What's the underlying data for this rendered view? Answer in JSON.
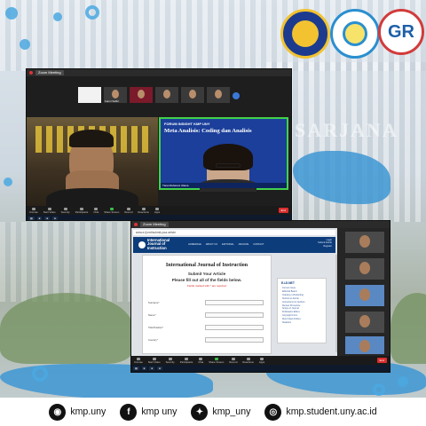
{
  "watermark": "SARJANA",
  "zoom_top": {
    "tabs": [
      "Zoom Meeting"
    ],
    "thumbnails": [
      {
        "name": ""
      },
      {
        "name": "Fanni Safitri"
      },
      {
        "name": ""
      },
      {
        "name": ""
      },
      {
        "name": ""
      },
      {
        "name": ""
      }
    ],
    "slide": {
      "header": "FORUM INSIGHT KMP UNY",
      "title": "Meta Analisis: Coding dan Analisis",
      "speaker_label": "Tiara Maharani Jiliana"
    },
    "toolbar": [
      "Unmute",
      "Start Video",
      "Security",
      "Participants",
      "Chat",
      "Share Screen",
      "Record",
      "Reactions",
      "Apps"
    ],
    "end_label": "End"
  },
  "zoom_bottom": {
    "address": "www.e-iji.net/submit-your-article",
    "journal_logo": "International Journal of Instruction",
    "nav": [
      "HOMEPAGE",
      "ABOUT US",
      "EDITORIAL",
      "ARCHIVE",
      "CONTACT"
    ],
    "login_links": [
      "Login",
      "Submit Article",
      "Register"
    ],
    "page_title": "International Journal of Instruction",
    "submit_heading": "Submit Your Article",
    "instruction": "Please fill out all of the fields below.",
    "required_note": "Fields marked with * are required",
    "fields": [
      "Surname*",
      "Name*",
      "Title/Position*",
      "Country*"
    ],
    "sidebar_title": "E-IJI.NET",
    "sidebar_links": [
      "Current Issue",
      "Editorial Board",
      "Indexing / Abstracting",
      "Submit an Article",
      "Instructions for Authors",
      "Review Procedure",
      "Scope of Journal",
      "Publication Ethics",
      "Copyright Form",
      "Most Cited Articles",
      "Statistics"
    ],
    "toolbar": [
      "Unmute",
      "Start Video",
      "Security",
      "Participants",
      "Chat",
      "Share Screen",
      "Record",
      "Reactions",
      "Apps"
    ],
    "end_label": "End"
  },
  "footer": {
    "instagram": "kmp.uny",
    "facebook": "kmp uny",
    "twitter": "kmp_uny",
    "website": "kmp.student.uny.ac.id"
  },
  "colors": {
    "accent_blue": "#4aa8e0",
    "slide_blue": "#1b3f9a",
    "journal_navy": "#0c3c7a"
  }
}
